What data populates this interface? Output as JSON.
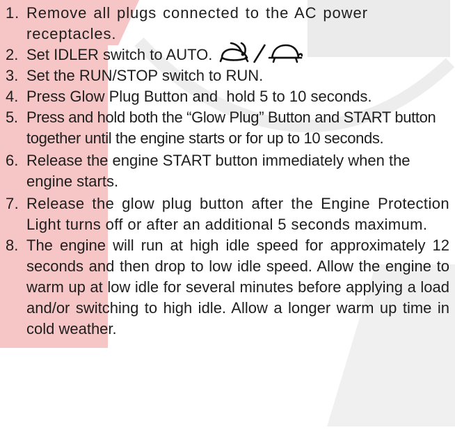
{
  "steps": [
    {
      "number": "1.",
      "text": "Remove all plugs connected to the AC power receptacles."
    },
    {
      "number": "2.",
      "text": "Set IDLER switch to AUTO."
    },
    {
      "number": "3.",
      "text": "Set the RUN/STOP switch to RUN."
    },
    {
      "number": "4.",
      "text": "Press Glow Plug Button and  hold 5 to 10 seconds."
    },
    {
      "number": "5.",
      "text": "Press and hold both the “Glow Plug” Button and START button together until the engine starts or for up to 10 seconds."
    },
    {
      "number": "6.",
      "text": " Release the engine START button immediately when the engine starts."
    },
    {
      "number": "7.",
      "text": "Release the glow plug button after the Engine Protection Light turns off or after an additional 5 seconds maximum."
    },
    {
      "number": "8.",
      "text": "The engine will run at high idle speed for approximately 12 seconds and then drop to low idle speed. Allow the engine to warm up at low idle for several minutes before applying a load and/or switching to high idle. Allow a longer warm up time in cold weather."
    }
  ],
  "icons": {
    "idler_icons": [
      "rabbit-icon",
      "slash-icon",
      "turtle-icon"
    ]
  },
  "colors": {
    "text": "#1e1e1e",
    "watermark_red": "#f6c6c6",
    "watermark_gray": "#ebebeb"
  }
}
